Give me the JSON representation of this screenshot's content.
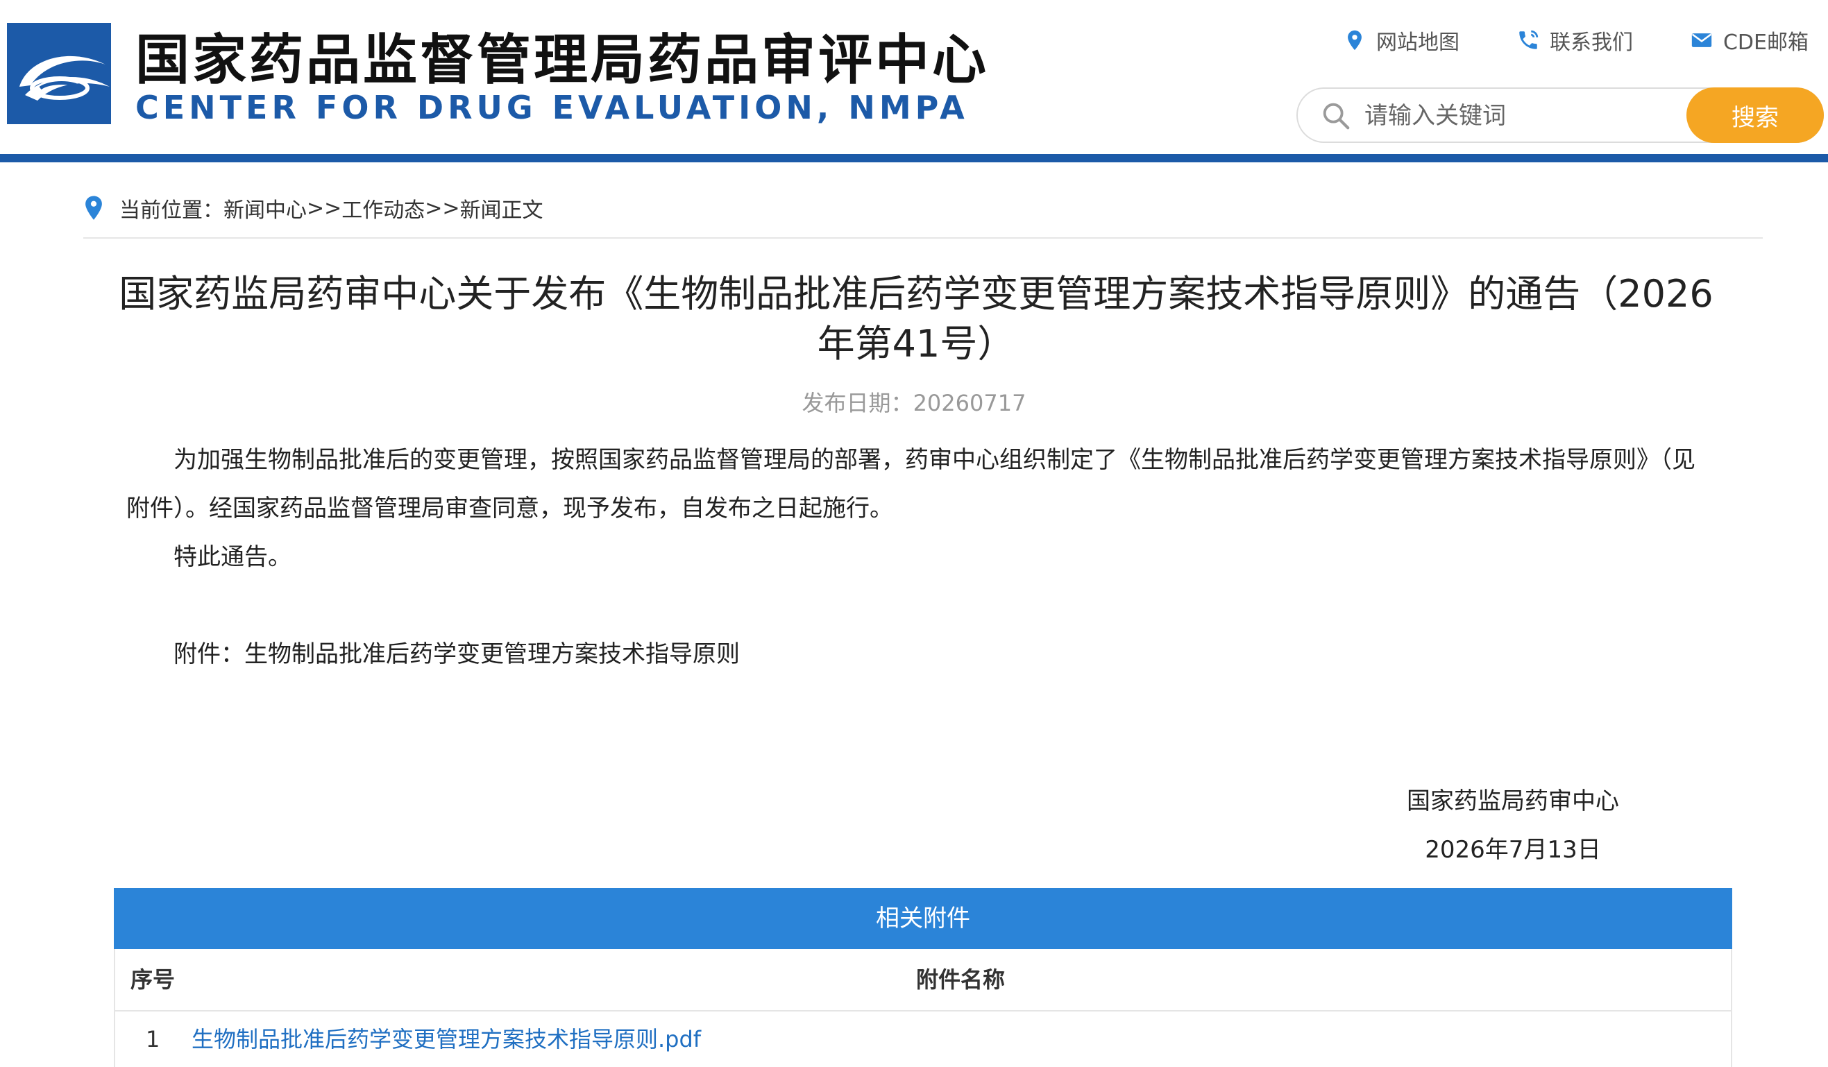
{
  "header": {
    "title_cn": "国家药品监督管理局药品审评中心",
    "title_en": "CENTER FOR DRUG EVALUATION, NMPA",
    "links": [
      {
        "label": "网站地图",
        "icon": "location-pin-icon"
      },
      {
        "label": "联系我们",
        "icon": "phone-icon"
      },
      {
        "label": "CDE邮箱",
        "icon": "mail-icon"
      }
    ],
    "search": {
      "placeholder": "请输入关键词",
      "value": "",
      "button_label": "搜索"
    },
    "colors": {
      "brand_blue": "#1c5aa8",
      "search_button": "#f5a623"
    }
  },
  "breadcrumb": {
    "prefix": "当前位置：",
    "items": [
      "新闻中心",
      "工作动态",
      "新闻正文"
    ],
    "separator": ">>"
  },
  "article": {
    "title": "国家药监局药审中心关于发布《生物制品批准后药学变更管理方案技术指导原则》的通告（2026年第41号）",
    "date_label": "发布日期：",
    "date_value": "20260717",
    "paragraphs": [
      "为加强生物制品批准后的变更管理，按照国家药品监督管理局的部署，药审中心组织制定了《生物制品批准后药学变更管理方案技术指导原则》（见附件）。经国家药品监督管理局审查同意，现予发布，自发布之日起施行。",
      "特此通告。",
      "",
      "附件：生物制品批准后药学变更管理方案技术指导原则"
    ],
    "signature_org": "国家药监局药审中心",
    "signature_date": "2026年7月13日"
  },
  "attachments": {
    "header": "相关附件",
    "columns": [
      "序号",
      "附件名称"
    ],
    "rows": [
      {
        "seq": "1",
        "name": "生物制品批准后药学变更管理方案技术指导原则.pdf"
      }
    ],
    "colors": {
      "header_bg": "#2b84d8",
      "link": "#1f6fc2"
    }
  }
}
